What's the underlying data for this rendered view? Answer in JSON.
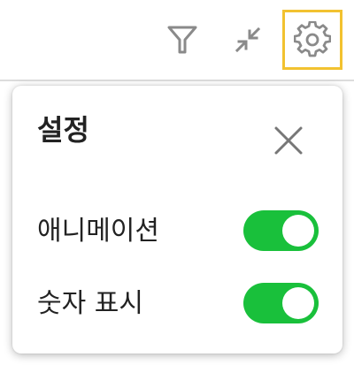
{
  "toolbar": {
    "icons": [
      "filter-icon",
      "minimize-icon",
      "gear-icon"
    ],
    "active_tool": "settings",
    "active_outline_color": "#f2c230"
  },
  "settings_panel": {
    "title": "설정",
    "close_icon": "close-icon",
    "options": [
      {
        "label": "애니메이션",
        "enabled": true
      },
      {
        "label": "숫자 표시",
        "enabled": true
      }
    ],
    "toggle_on_color": "#19c03b"
  }
}
